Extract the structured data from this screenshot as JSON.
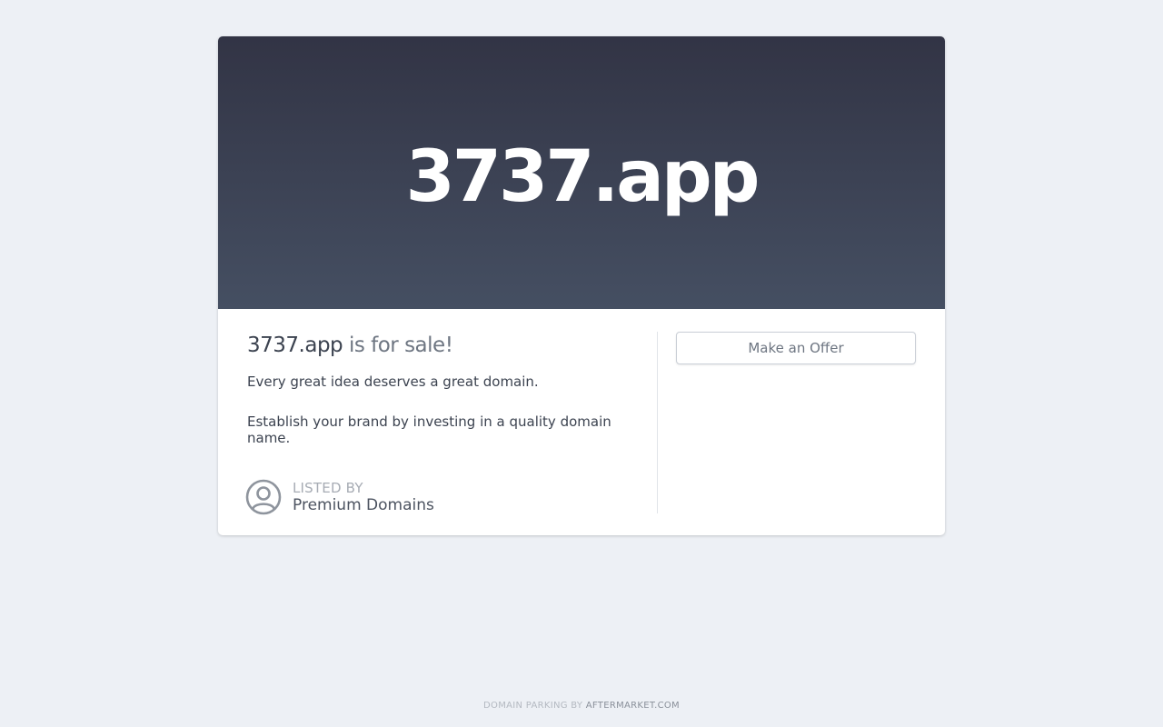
{
  "hero": {
    "domain": "3737.app"
  },
  "sale": {
    "domain": "3737.app",
    "suffix": " is for sale!",
    "line1": "Every great idea deserves a great domain.",
    "line2": "Establish your brand by investing in a quality domain name."
  },
  "offer": {
    "button_label": "Make an Offer"
  },
  "listed": {
    "label": "LISTED BY",
    "name": "Premium Domains",
    "icon": "user-circle-icon"
  },
  "footer": {
    "prefix": "DOMAIN PARKING BY ",
    "brand": "AFTERMARKET.COM"
  },
  "colors": {
    "background": "#edf0f5",
    "hero_top": "#323445",
    "hero_bottom": "#454f62"
  }
}
